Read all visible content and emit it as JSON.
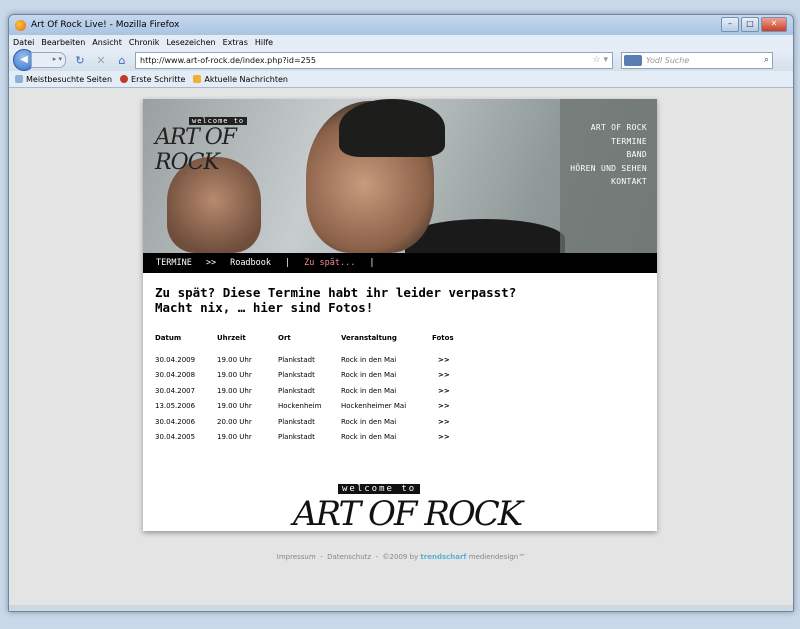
{
  "window": {
    "title": "Art Of Rock Live! - Mozilla Firefox",
    "menu": [
      "Datei",
      "Bearbeiten",
      "Ansicht",
      "Chronik",
      "Lesezeichen",
      "Extras",
      "Hilfe"
    ],
    "url": "http://www.art-of-rock.de/index.php?id=255",
    "search_placeholder": "Yodl Suche",
    "bookmarks": [
      "Meistbesuchte Seiten",
      "Erste Schritte",
      "Aktuelle Nachrichten"
    ]
  },
  "site": {
    "logo_small": "welcome to",
    "logo_big": "ART OF ROCK",
    "nav": [
      "ART OF ROCK",
      "TERMINE",
      "BAND",
      "HÖREN UND SEHEN",
      "KONTAKT"
    ],
    "breadcrumb": {
      "first": "TERMINE",
      "sep1": ">>",
      "second": "Roadbook",
      "sep2": "|",
      "third": "Zu spät...",
      "sep3": "|"
    },
    "headline_1": "Zu spät? Diese Termine habt ihr leider verpasst?",
    "headline_2": "Macht nix, … hier sind Fotos!",
    "table": {
      "headers": [
        "Datum",
        "Uhrzeit",
        "Ort",
        "Veranstaltung",
        "Fotos"
      ],
      "rows": [
        [
          "30.04.2009",
          "19.00 Uhr",
          "Plankstadt",
          "Rock in den Mai",
          ">>"
        ],
        [
          "30.04.2008",
          "19.00 Uhr",
          "Plankstadt",
          "Rock in den Mai",
          ">>"
        ],
        [
          "30.04.2007",
          "19.00 Uhr",
          "Plankstadt",
          "Rock in den Mai",
          ">>"
        ],
        [
          "13.05.2006",
          "19.00 Uhr",
          "Hockenheim",
          "Hockenheimer Mai",
          ">>"
        ],
        [
          "30.04.2006",
          "20.00 Uhr",
          "Plankstadt",
          "Rock in den Mai",
          ">>"
        ],
        [
          "30.04.2005",
          "19.00 Uhr",
          "Plankstadt",
          "Rock in den Mai",
          ">>"
        ]
      ]
    },
    "footer": {
      "impressum": "Impressum",
      "dot1": "-",
      "datenschutz": "Datenschutz",
      "dot2": "-",
      "copyright": "©2009 by",
      "brand": "trendscharf",
      "brand_rest": "mediendesign™"
    },
    "colors": {
      "accent": "#f08a8a",
      "brand": "#5ab0d8"
    }
  }
}
